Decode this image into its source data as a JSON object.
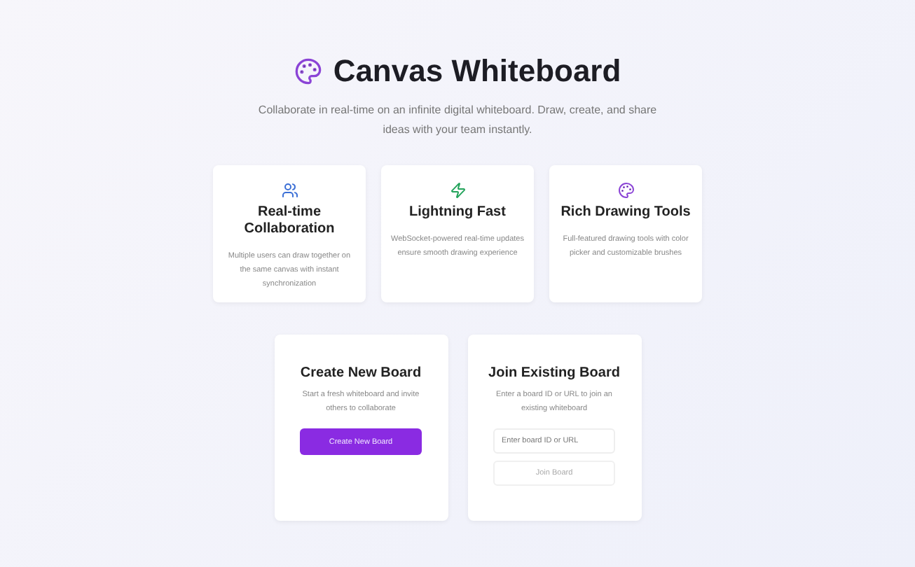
{
  "header": {
    "title": "Canvas Whiteboard",
    "subtitle": "Collaborate in real-time on an infinite digital whiteboard. Draw, create, and share ideas with your team instantly."
  },
  "features": [
    {
      "kind": "people",
      "color": "#3b6fd6",
      "title": "Real-time Collaboration",
      "text": "Multiple users can draw together on the same canvas with instant synchronization"
    },
    {
      "kind": "speed",
      "color": "#22a35a",
      "title": "Lightning Fast",
      "text": "WebSocket-powered real-time updates ensure smooth drawing experience"
    },
    {
      "kind": "tools",
      "color": "#8b44d6",
      "title": "Rich Drawing Tools",
      "text": "Full-featured drawing tools with color picker and customizable brushes"
    }
  ],
  "create": {
    "title": "Create New Board",
    "text": "Start a fresh whiteboard and invite others to collaborate",
    "button": "Create New Board"
  },
  "join": {
    "title": "Join Existing Board",
    "text": "Enter a board ID or URL to join an existing whiteboard",
    "placeholder": "Enter board ID or URL",
    "button": {
      "label": "Join Board",
      "disabled": true
    }
  }
}
